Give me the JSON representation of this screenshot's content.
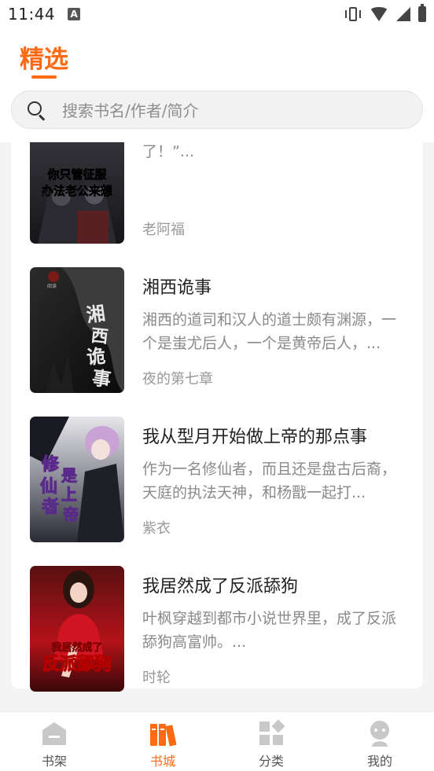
{
  "status_bar": {
    "time": "11:44",
    "notification_letter": "A"
  },
  "header": {
    "title": "精选"
  },
  "search": {
    "placeholder": "搜索书名/作者/简介"
  },
  "books": [
    {
      "title": "",
      "description": "“艾思斯总督，你因为勾结魔族被捕了！”...",
      "author": "老阿福",
      "cover_text": "你只管征服，办法老公来想"
    },
    {
      "title": "湘西诡事",
      "description": "湘西的道司和汉人的道士颇有渊源，一个是蚩尤后人，一个是黄帝后人，...",
      "author": "夜的第七章",
      "cover_text": "湘西诡事"
    },
    {
      "title": "我从型月开始做上帝的那点事",
      "description": "作为一名修仙者，而且还是盘古后裔，天庭的执法天神，和杨戬一起打...",
      "author": "紫衣",
      "cover_text": "修仙者是上帝"
    },
    {
      "title": "我居然成了反派舔狗",
      "description": "叶枫穿越到都市小说世界里，成了反派舔狗高富帅。...",
      "author": "时轮",
      "cover_text": "我居然成了反派舔狗"
    }
  ],
  "bottom_nav": {
    "items": [
      {
        "label": "书架",
        "icon": "bookshelf-icon",
        "active": false
      },
      {
        "label": "书城",
        "icon": "bookstore-icon",
        "active": true
      },
      {
        "label": "分类",
        "icon": "category-icon",
        "active": false
      },
      {
        "label": "我的",
        "icon": "profile-icon",
        "active": false
      }
    ]
  },
  "colors": {
    "accent": "#ff6a13",
    "inactive_icon": "#c8c8c8"
  }
}
